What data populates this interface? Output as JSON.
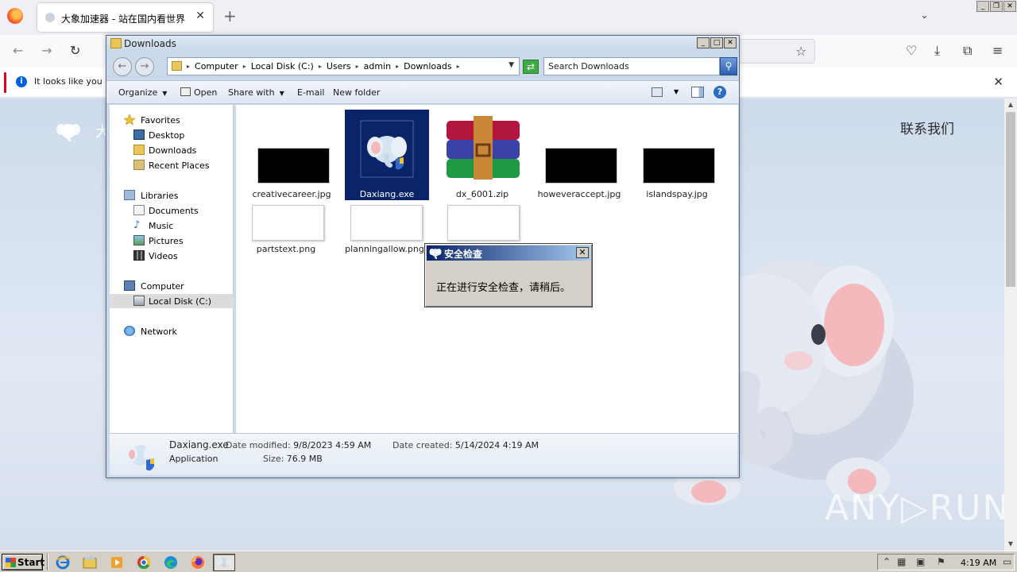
{
  "browser": {
    "tab_title": "大象加速器 - 站在国内看世界",
    "notification": "It looks like you ha"
  },
  "page": {
    "brand_text": "大",
    "contact": "联系我们",
    "watermark": "ANY▷RUN"
  },
  "explorer": {
    "title": "Downloads",
    "breadcrumbs": [
      "Computer",
      "Local Disk (C:)",
      "Users",
      "admin",
      "Downloads"
    ],
    "search_placeholder": "Search Downloads",
    "toolbar": {
      "organize": "Organize",
      "open": "Open",
      "share_with": "Share with",
      "email": "E-mail",
      "new_folder": "New folder"
    },
    "nav": {
      "favorites": "Favorites",
      "desktop": "Desktop",
      "downloads": "Downloads",
      "recent_places": "Recent Places",
      "libraries": "Libraries",
      "documents": "Documents",
      "music": "Music",
      "pictures": "Pictures",
      "videos": "Videos",
      "computer": "Computer",
      "local_disk": "Local Disk (C:)",
      "network": "Network"
    },
    "files": [
      {
        "name": "creativecareer.jpg"
      },
      {
        "name": "Daxiang.exe"
      },
      {
        "name": "dx_6001.zip"
      },
      {
        "name": "howeveraccept.jpg"
      },
      {
        "name": "islandspay.jpg"
      },
      {
        "name": "partstext.png"
      },
      {
        "name": "planningallow.png"
      },
      {
        "name": ""
      }
    ],
    "details": {
      "name": "Daxiang.exe",
      "type": "Application",
      "modified_label": "Date modified:",
      "modified_value": "9/8/2023 4:59 AM",
      "created_label": "Date created:",
      "created_value": "5/14/2024 4:19 AM",
      "size_label": "Size:",
      "size_value": "76.9 MB"
    }
  },
  "dialog": {
    "title": "安全检查",
    "message": "正在进行安全检查，请稍后。"
  },
  "taskbar": {
    "start": "Start",
    "clock": "4:19 AM"
  },
  "colors": {
    "selection": "#0a246a",
    "dialog_title_start": "#0a246a",
    "page_bg": "#cddbec"
  }
}
